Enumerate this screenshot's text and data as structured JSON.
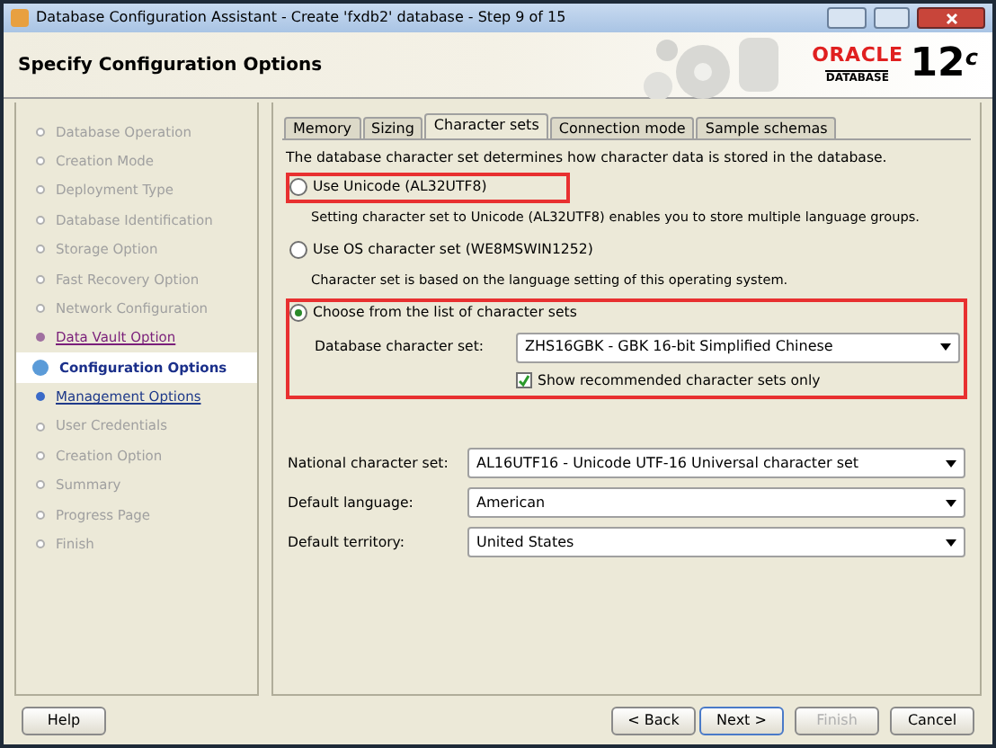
{
  "window": {
    "title": "Database Configuration Assistant - Create 'fxdb2' database - Step 9 of 15"
  },
  "header": {
    "title": "Specify Configuration Options",
    "logo_brand": "ORACLE",
    "logo_product": "DATABASE",
    "logo_version": "12",
    "logo_suffix": "c"
  },
  "steps": [
    {
      "label": "Database Operation",
      "kind": "plain",
      "selected": false
    },
    {
      "label": "Creation Mode",
      "kind": "plain",
      "selected": false
    },
    {
      "label": "Deployment Type",
      "kind": "plain",
      "selected": false
    },
    {
      "label": "Database Identification",
      "kind": "plain",
      "selected": false
    },
    {
      "label": "Storage Option",
      "kind": "plain",
      "selected": false
    },
    {
      "label": "Fast Recovery Option",
      "kind": "plain",
      "selected": false
    },
    {
      "label": "Network Configuration",
      "kind": "plain",
      "selected": false
    },
    {
      "label": "Data Vault Option",
      "kind": "visited",
      "selected": false
    },
    {
      "label": "Configuration Options",
      "kind": "current",
      "selected": true
    },
    {
      "label": "Management Options",
      "kind": "link",
      "selected": false
    },
    {
      "label": "User Credentials",
      "kind": "plain",
      "selected": false
    },
    {
      "label": "Creation Option",
      "kind": "plain",
      "selected": false
    },
    {
      "label": "Summary",
      "kind": "plain",
      "selected": false
    },
    {
      "label": "Progress Page",
      "kind": "plain",
      "selected": false
    },
    {
      "label": "Finish",
      "kind": "plain",
      "selected": false
    }
  ],
  "tabs": [
    {
      "label": "Memory",
      "selected": false
    },
    {
      "label": "Sizing",
      "selected": false
    },
    {
      "label": "Character sets",
      "selected": true
    },
    {
      "label": "Connection mode",
      "selected": false
    },
    {
      "label": "Sample schemas",
      "selected": false
    }
  ],
  "intro": "The database character set determines how character data is stored in the database.",
  "options": [
    {
      "label": "Use Unicode (AL32UTF8)",
      "selected": false,
      "highlighted": true,
      "note": "Setting character set to Unicode (AL32UTF8) enables you to store multiple language groups."
    },
    {
      "label": "Use OS character set (WE8MSWIN1252)",
      "selected": false,
      "highlighted": false,
      "note": "Character set is based on the language setting of this operating system."
    },
    {
      "label": "Choose from the list of character sets",
      "selected": true,
      "highlighted": true,
      "select_label": "Database character set:",
      "select_value": "ZHS16GBK - GBK 16-bit Simplified Chinese",
      "checkbox": {
        "label": "Show recommended character sets only",
        "checked": true
      }
    }
  ],
  "settings": [
    {
      "label": "National character set:",
      "value": "AL16UTF16 - Unicode UTF-16 Universal character set"
    },
    {
      "label": "Default language:",
      "value": "American"
    },
    {
      "label": "Default territory:",
      "value": "United States"
    }
  ],
  "buttons": [
    {
      "label": "Help",
      "disabled": false,
      "focused": false
    },
    {
      "label": "< Back",
      "disabled": false,
      "focused": false
    },
    {
      "label": "Next >",
      "disabled": false,
      "focused": true
    },
    {
      "label": "Finish",
      "disabled": true,
      "focused": false
    },
    {
      "label": "Cancel",
      "disabled": false,
      "focused": false
    }
  ]
}
